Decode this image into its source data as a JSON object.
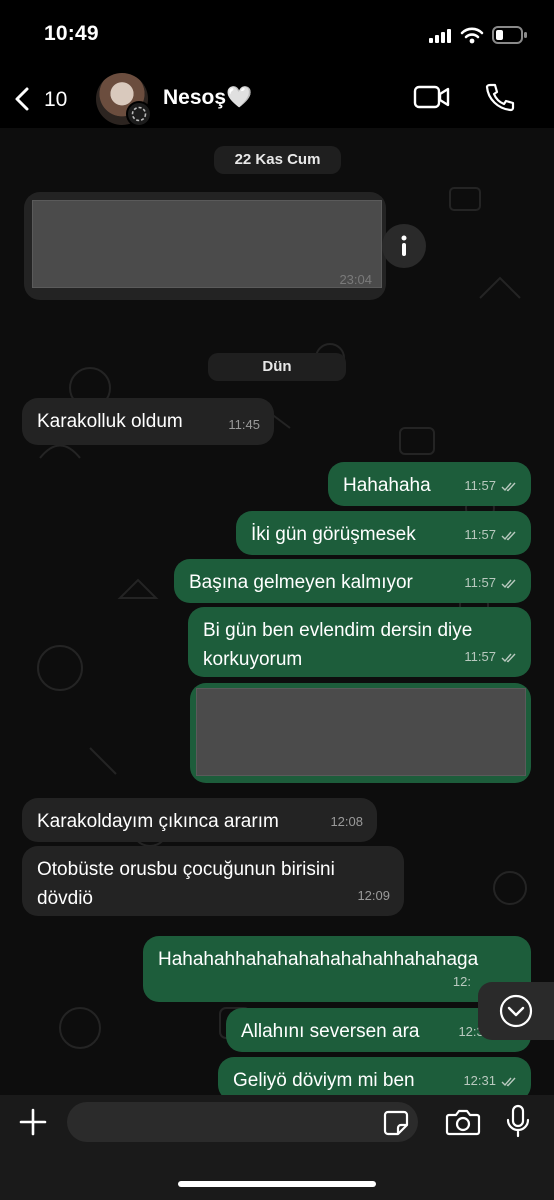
{
  "status_bar": {
    "time": "10:49"
  },
  "header": {
    "back_count": "10",
    "contact_name": "Nesoş🤍"
  },
  "chat": {
    "date_1": "22 Kas Cum",
    "date_2": "Dün",
    "first_media_time": "23:04",
    "messages": [
      {
        "id": "m1",
        "direction": "in",
        "text": "Karakolluk oldum",
        "time": "11:45"
      },
      {
        "id": "m2",
        "direction": "out",
        "text": "Hahahaha",
        "time": "11:57"
      },
      {
        "id": "m3",
        "direction": "out",
        "text": "İki gün görüşmesek",
        "time": "11:57"
      },
      {
        "id": "m4",
        "direction": "out",
        "text": "Başına gelmeyen kalmıyor",
        "time": "11:57"
      },
      {
        "id": "m5",
        "direction": "out",
        "text": "Bi gün ben evlendim dersin diye\nkorkuyorum",
        "time": "11:57"
      },
      {
        "id": "m6",
        "direction": "in",
        "text": "Karakoldayım çıkınca ararım",
        "time": "12:08"
      },
      {
        "id": "m7",
        "direction": "in",
        "text": "Otobüste orusbu çocuğunun birisini\ndövdiö",
        "time": "12:09"
      },
      {
        "id": "m8",
        "direction": "out",
        "text": "Hahahahhahahahahahahahhahahaga",
        "time": "12:"
      },
      {
        "id": "m9",
        "direction": "out",
        "text": "Allahını seversen ara",
        "time": "12:30"
      },
      {
        "id": "m10",
        "direction": "out",
        "text": "Geliyö döviym mi ben",
        "time": "12:31"
      }
    ]
  },
  "input": {
    "placeholder": ""
  },
  "colors": {
    "outgoing_bubble": "#1d5d3b",
    "incoming_bubble": "#232323",
    "background": "#0d0d0d"
  }
}
